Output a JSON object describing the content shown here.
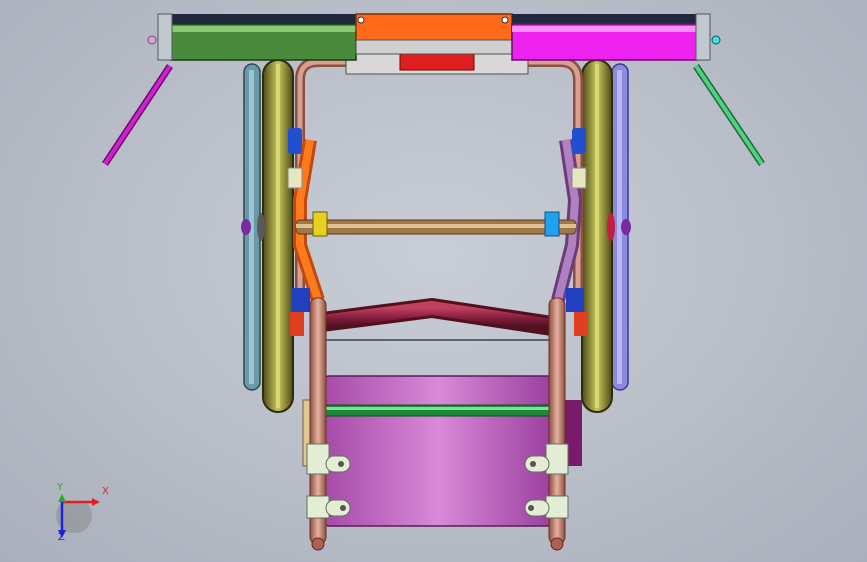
{
  "viewport": {
    "background": "#b9bec9"
  },
  "model": {
    "parts": {
      "top_left_panel": "#4a8a3c",
      "top_center_panel": "#ff6a1a",
      "top_right_panel": "#ee22ee",
      "panel_cap": "#202840",
      "frame_tube": "#c98a72",
      "wheel_rim": "#8a8a2a",
      "left_handrim": "#6a9aa8",
      "right_handrim": "#8a8ae0",
      "footrest_bar": "#8a2040",
      "seat_panel": "#c36ac9",
      "green_bar": "#2ab24a",
      "cross_bar": "#c49a6a",
      "left_strut": "#ff7a1a",
      "right_strut": "#a070b0",
      "left_brace": "#d020d0",
      "right_brace": "#50d080",
      "yellow_clamp": "#e6d020",
      "blue_clamp": "#20a0f0",
      "red_bracket": "#e02020"
    }
  },
  "triad": {
    "x_label": "X",
    "y_label": "Y",
    "z_label": "Z",
    "x_color": "#e02020",
    "y_color": "#20b020",
    "z_color": "#2020e0"
  }
}
